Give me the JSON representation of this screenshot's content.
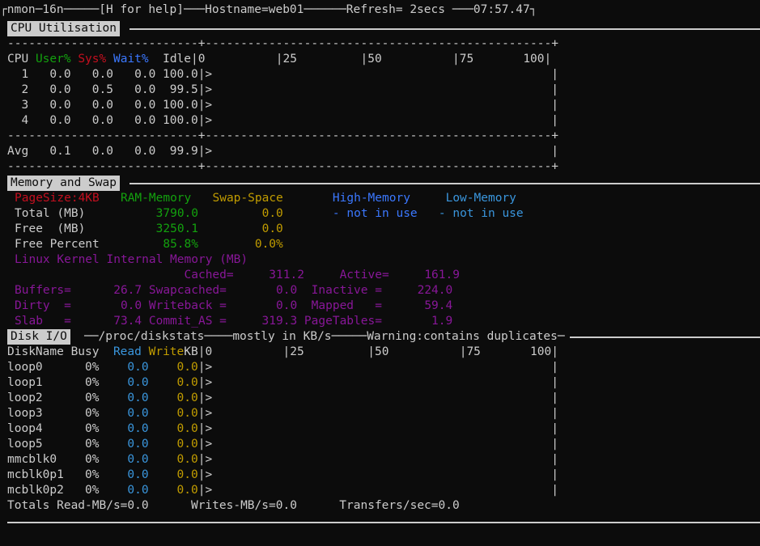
{
  "title_bar": "┌nmon─16n─────[H for help]───Hostname=web01──────Refresh= 2secs ───07:57.47┐",
  "cpu": {
    "section_title": "CPU Utilisation",
    "sep": "---------------------------+-------------------------------------------------+",
    "header_cpu": "CPU",
    "header_user": "User%",
    "header_sys": "Sys%",
    "header_wait": "Wait%",
    "header_rest": "  Idle|0          |25         |50          |75       100|",
    "rows": [
      "  1   0.0   0.0   0.0 100.0|>                                                |",
      "  2   0.0   0.5   0.0  99.5|>                                                |",
      "  3   0.0   0.0   0.0 100.0|>                                                |",
      "  4   0.0   0.0   0.0 100.0|>                                                |"
    ],
    "avg": "Avg   0.1   0.0   0.0  99.9|>                                                |"
  },
  "memory": {
    "section_title": "Memory and Swap",
    "pagesize": "PageSize:4KB",
    "ram_memory": "RAM-Memory",
    "swap_space": "Swap-Space",
    "high_memory": "High-Memory",
    "low_memory": "Low-Memory",
    "total_label": "Total (MB)",
    "total_ram": "3790.0",
    "total_swap": "0.0",
    "high_not_in_use": "- not in use",
    "low_not_in_use": "- not in use",
    "free_label": "Free  (MB)",
    "free_ram": "3250.1",
    "free_swap": "0.0",
    "free_pct_label": "Free Percent",
    "free_pct_ram": "85.8%",
    "free_pct_swap": "0.0%",
    "kernel_title": "Linux Kernel Internal Memory (MB)",
    "kernel_rows": [
      "                        Cached=     311.2     Active=     161.9",
      "Buffers=      26.7 Swapcached=       0.0  Inactive =     224.0",
      "Dirty  =       0.0 Writeback =       0.0  Mapped   =      59.4",
      "Slab   =      73.4 Commit_AS =     319.3 PageTables=       1.9"
    ]
  },
  "disk": {
    "section_title": "Disk I/O",
    "title_rest": "──/proc/diskstats────mostly in KB/s─────Warning:contains duplicates─",
    "header_name_busy": "DiskName Busy  ",
    "header_read": "Read",
    "header_write": " Write",
    "header_rest": "KB|0          |25         |50          |75       100|",
    "rows": [
      {
        "name": "loop0      ",
        "busy": "0%    ",
        "read": "0.0",
        "write": "    0.0",
        "bar": "|>                                                |"
      },
      {
        "name": "loop1      ",
        "busy": "0%    ",
        "read": "0.0",
        "write": "    0.0",
        "bar": "|>                                                |"
      },
      {
        "name": "loop2      ",
        "busy": "0%    ",
        "read": "0.0",
        "write": "    0.0",
        "bar": "|>                                                |"
      },
      {
        "name": "loop3      ",
        "busy": "0%    ",
        "read": "0.0",
        "write": "    0.0",
        "bar": "|>                                                |"
      },
      {
        "name": "loop4      ",
        "busy": "0%    ",
        "read": "0.0",
        "write": "    0.0",
        "bar": "|>                                                |"
      },
      {
        "name": "loop5      ",
        "busy": "0%    ",
        "read": "0.0",
        "write": "    0.0",
        "bar": "|>                                                |"
      },
      {
        "name": "mmcblk0    ",
        "busy": "0%    ",
        "read": "0.0",
        "write": "    0.0",
        "bar": "|>                                                |"
      },
      {
        "name": "mcblk0p1   ",
        "busy": "0%    ",
        "read": "0.0",
        "write": "    0.0",
        "bar": "|>                                                |"
      },
      {
        "name": "mcblk0p2   ",
        "busy": "0%    ",
        "read": "0.0",
        "write": "    0.0",
        "bar": "|>                                                |"
      }
    ],
    "totals": "Totals Read-MB/s=0.0      Writes-MB/s=0.0      Transfers/sec=0.0"
  },
  "colors": {
    "background": "#0c0c0c",
    "text": "#cccccc",
    "user": "#13a10e",
    "sys": "#c50f1f",
    "wait": "#3b78ff",
    "swap": "#c19c00",
    "kernel": "#881798",
    "read": "#3a96dd"
  }
}
